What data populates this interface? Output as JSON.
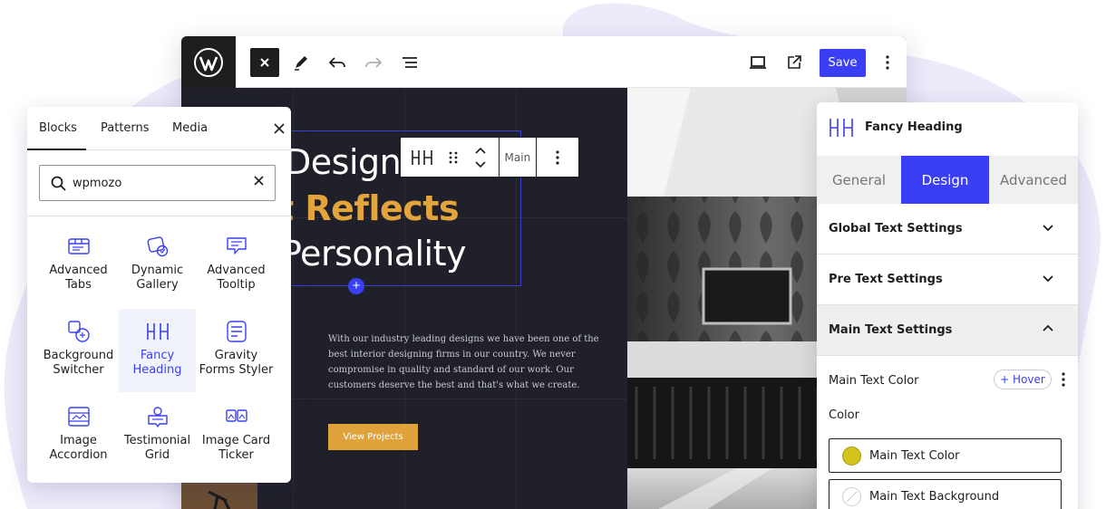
{
  "topbar": {
    "save_label": "Save",
    "icons": [
      "wordpress-logo",
      "close-icon",
      "pencil-icon",
      "undo-icon",
      "redo-icon",
      "list-view-icon",
      "desktop-preview-icon",
      "external-link-icon",
      "more-options-icon"
    ]
  },
  "canvas": {
    "heading_line1": "Design",
    "heading_line2": "t Reflects",
    "heading_line3": "Personality",
    "body_text": "With our industry leading designs we have been one of the best interior designing firms in our country. We never compromise in quality and standard of our work. Our customers deserve the best and that's what we create.",
    "button_label": "View Projects",
    "accent_color": "#e3a43c"
  },
  "block_toolbar": {
    "style_label": "Main"
  },
  "blocks_panel": {
    "tabs": [
      "Blocks",
      "Patterns",
      "Media"
    ],
    "active_tab": "Blocks",
    "search_value": "wpmozo",
    "blocks": [
      {
        "line1": "Advanced",
        "line2": "Tabs",
        "icon": "advanced-tabs-icon"
      },
      {
        "line1": "Dynamic",
        "line2": "Gallery",
        "icon": "dynamic-gallery-icon"
      },
      {
        "line1": "Advanced",
        "line2": "Tooltip",
        "icon": "advanced-tooltip-icon"
      },
      {
        "line1": "Background",
        "line2": "Switcher",
        "icon": "background-switcher-icon"
      },
      {
        "line1": "Fancy",
        "line2": "Heading",
        "icon": "fancy-heading-icon"
      },
      {
        "line1": "Gravity",
        "line2": "Forms Styler",
        "icon": "gravity-forms-icon"
      },
      {
        "line1": "Image",
        "line2": "Accordion",
        "icon": "image-accordion-icon"
      },
      {
        "line1": "Testimonial",
        "line2": "Grid",
        "icon": "testimonial-grid-icon"
      },
      {
        "line1": "Image Card",
        "line2": "Ticker",
        "icon": "image-card-ticker-icon"
      }
    ],
    "selected_block": "Fancy Heading"
  },
  "inspector": {
    "block_title": "Fancy Heading",
    "tabs": [
      "General",
      "Design",
      "Advanced"
    ],
    "active_tab": "Design",
    "sections": [
      {
        "label": "Global Text Settings",
        "open": false
      },
      {
        "label": "Pre Text Settings",
        "open": false
      },
      {
        "label": "Main Text Settings",
        "open": true
      }
    ],
    "main_text_color_label": "Main Text Color",
    "hover_label": "+ Hover",
    "color_label": "Color",
    "color_options": [
      {
        "label": "Main Text Color",
        "swatch": "#d4c21d"
      },
      {
        "label": "Main Text Background",
        "swatch": "none"
      }
    ],
    "brand_color": "#3a3ff5"
  }
}
